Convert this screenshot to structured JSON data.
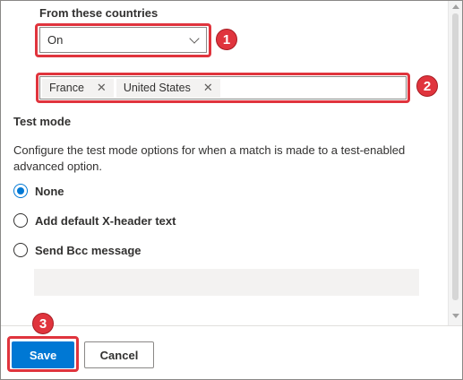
{
  "countries": {
    "label": "From these countries",
    "dropdown_value": "On",
    "tags": [
      {
        "label": "France",
        "remove": "✕"
      },
      {
        "label": "United States",
        "remove": "✕"
      }
    ]
  },
  "test_mode": {
    "title": "Test mode",
    "description": "Configure the test mode options for when a match is made to a test-enabled advanced option.",
    "options": [
      {
        "label": "None",
        "checked": true
      },
      {
        "label": "Add default X-header text",
        "checked": false
      },
      {
        "label": "Send Bcc message",
        "checked": false
      }
    ]
  },
  "callouts": [
    "1",
    "2",
    "3"
  ],
  "footer": {
    "save_label": "Save",
    "cancel_label": "Cancel"
  },
  "colors": {
    "accent": "#0078d4",
    "callout": "#e0343d"
  }
}
